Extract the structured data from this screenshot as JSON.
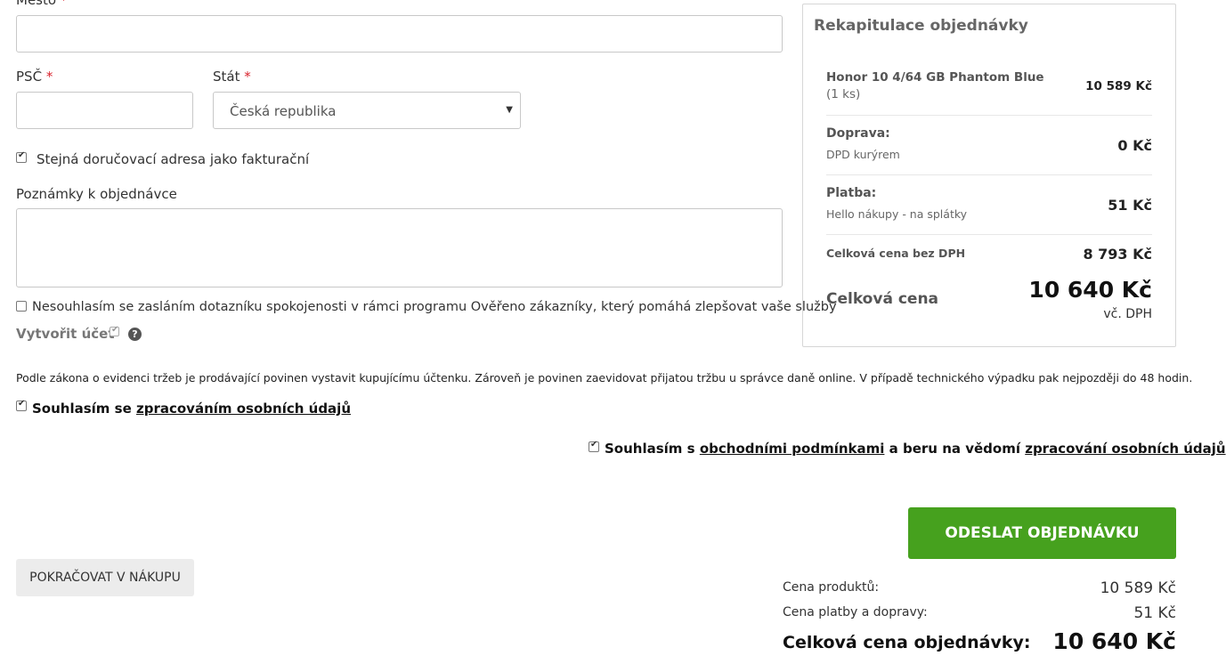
{
  "form": {
    "city_label": "Město",
    "zip_label": "PSČ",
    "country_label": "Stát",
    "required_mark": "*",
    "country_value": "Česká republika",
    "country_arrow": "▼",
    "same_address_label": "Stejná doručovací adresa jako fakturační",
    "notes_label": "Poznámky k objednávce",
    "survey_optout_label": "Nesouhlasím se zasláním dotazníku spokojenosti v rámci programu Ověřeno zákazníky, který pomáhá zlepšovat vaše služby",
    "create_account_label": "Vytvořit účet",
    "help_glyph": "?"
  },
  "summary": {
    "title": "Rekapitulace objednávky",
    "product_name": "Honor 10 4/64 GB Phantom Blue",
    "product_qty": "(1 ks)",
    "product_price": "10 589 Kč",
    "shipping_label": "Doprava:",
    "shipping_method": "DPD kurýrem",
    "shipping_price": "0 Kč",
    "payment_label": "Platba:",
    "payment_method": "Hello nákupy - na splátky",
    "payment_price": "51 Kč",
    "net_label": "Celková cena bez DPH",
    "net_price": "8 793 Kč",
    "total_label": "Celková cena",
    "total_price": "10 640 Kč",
    "vat_note": "vč. DPH"
  },
  "legal": {
    "eet_notice": "Podle zákona o evidenci tržeb je prodávající povinen vystavit kupujícímu účtenku. Zároveň je povinen zaevidovat přijatou tržbu u správce daně online. V případě technického výpadku pak nejpozději do 48 hodin.",
    "consent_prefix": "Souhlasím se",
    "consent_link": "zpracováním osobních údajů",
    "terms_prefix": "Souhlasím s",
    "terms_link": "obchodními podmínkami",
    "terms_middle": "a beru na vědomí",
    "terms_link2": "zpracování osobních údajů",
    "terms_suffix": "."
  },
  "actions": {
    "submit_label": "ODESLAT OBJEDNÁVKU",
    "continue_label": "POKRAČOVAT V NÁKUPU"
  },
  "totals": {
    "products_label": "Cena produktů:",
    "products_value": "10 589 Kč",
    "shipping_payment_label": "Cena platby a dopravy:",
    "shipping_payment_value": "51 Kč",
    "order_total_label": "Celková cena objednávky:",
    "order_total_value": "10 640 Kč"
  },
  "checkboxes": {
    "same_address": true,
    "survey_optout": false,
    "create_account": true,
    "consent": true,
    "terms": true
  }
}
